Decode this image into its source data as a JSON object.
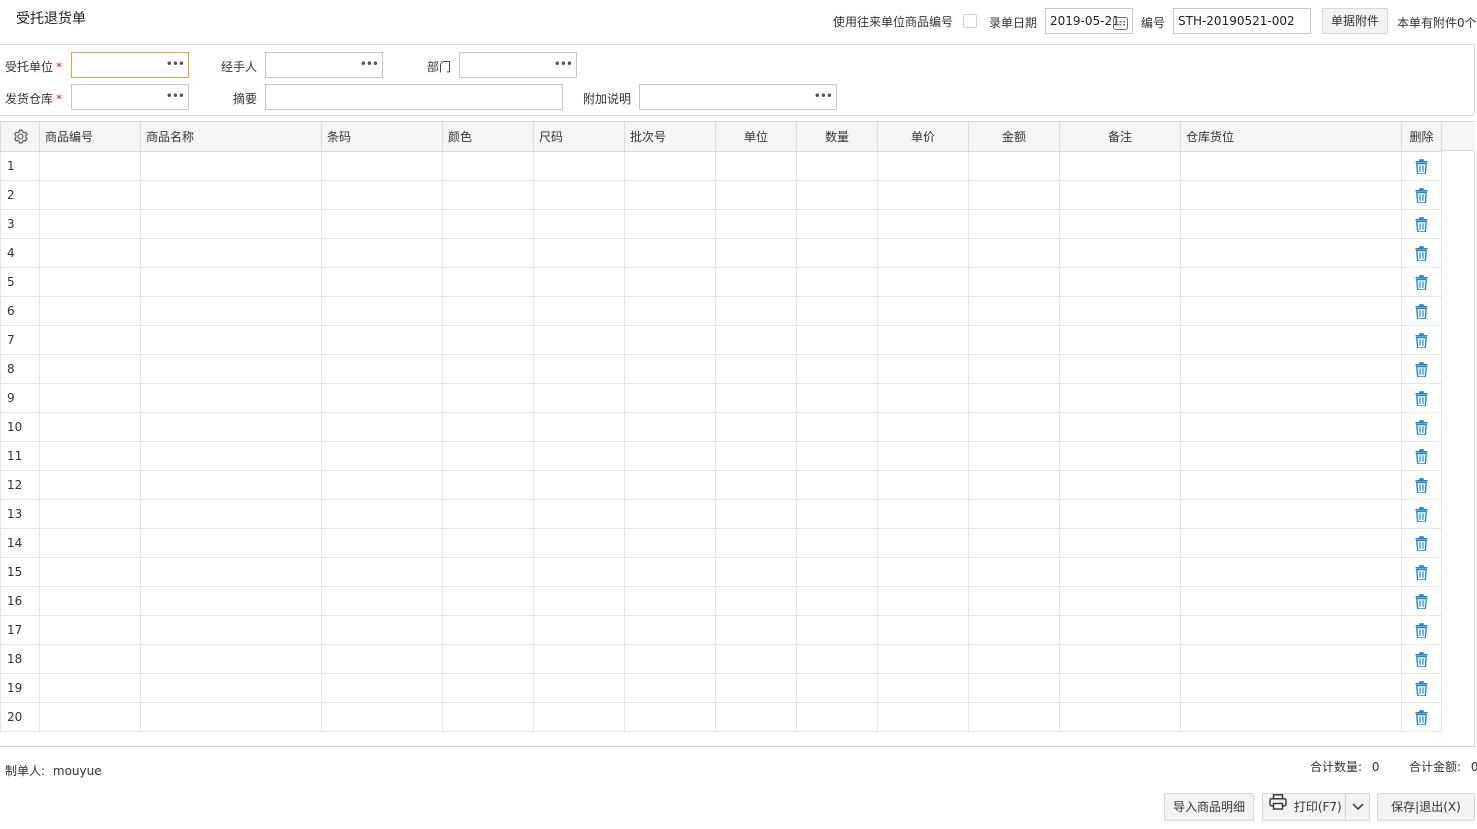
{
  "header": {
    "title": "受托退货单",
    "use_partner_code_label": "使用往来单位商品编号",
    "entry_date_label": "录单日期",
    "entry_date_value": "2019-05-21",
    "number_label": "编号",
    "number_value": "STH-20190521-002",
    "attachment_button": "单据附件",
    "attachment_count_text": "本单有附件0个"
  },
  "form": {
    "consignor_label": "受托单位",
    "handler_label": "经手人",
    "department_label": "部门",
    "warehouse_label": "发货仓库",
    "summary_label": "摘要",
    "note_label": "附加说明",
    "required_mark": "*",
    "dots": "•••"
  },
  "grid": {
    "columns": [
      "商品编号",
      "商品名称",
      "条码",
      "颜色",
      "尺码",
      "批次号",
      "单位",
      "数量",
      "单价",
      "金额",
      "备注",
      "仓库货位",
      "删除"
    ],
    "rows": [
      "1",
      "2",
      "3",
      "4",
      "5",
      "6",
      "7",
      "8",
      "9",
      "10",
      "11",
      "12",
      "13",
      "14",
      "15",
      "16",
      "17",
      "18",
      "19",
      "20"
    ]
  },
  "footer": {
    "creator_label": "制单人:",
    "creator_value": "mouyue",
    "total_qty_label": "合计数量:",
    "total_qty_value": "0",
    "total_amount_label": "合计金额:",
    "total_amount_value": "0",
    "import_button": "导入商品明细",
    "print_button": "打印(F7)",
    "save_exit_button": "保存|退出(X)"
  },
  "colors": {
    "delete_icon": "#1e88d6",
    "focus_border": "#e8a33d",
    "required": "#e02020"
  }
}
